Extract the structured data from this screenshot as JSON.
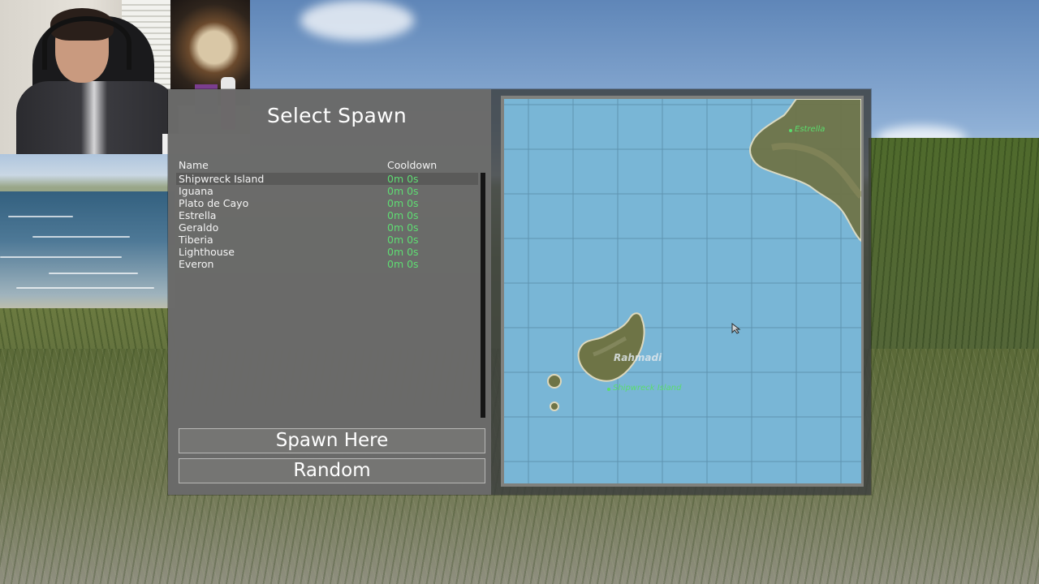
{
  "dialog": {
    "title": "Select Spawn",
    "columns": {
      "name": "Name",
      "cooldown": "Cooldown"
    },
    "spawns": [
      {
        "name": "Shipwreck Island",
        "cooldown": "0m 0s",
        "selected": true
      },
      {
        "name": "Iguana",
        "cooldown": "0m 0s"
      },
      {
        "name": "Plato de Cayo",
        "cooldown": "0m 0s"
      },
      {
        "name": "Estrella",
        "cooldown": "0m 0s"
      },
      {
        "name": "Geraldo",
        "cooldown": "0m 0s"
      },
      {
        "name": "Tiberia",
        "cooldown": "0m 0s"
      },
      {
        "name": "Lighthouse",
        "cooldown": "0m 0s"
      },
      {
        "name": "Everon",
        "cooldown": "0m 0s"
      }
    ],
    "buttons": {
      "spawn_here": "Spawn Here",
      "random": "Random"
    }
  },
  "map": {
    "region_label": "Rahmadi",
    "location_labels": {
      "estrella": "Estrella",
      "shipwreck_island": "Shipwreck Island"
    },
    "colors": {
      "water": "#79b6d6",
      "label_green": "#5bdc6d",
      "cooldown_green": "#5fdc73"
    }
  }
}
